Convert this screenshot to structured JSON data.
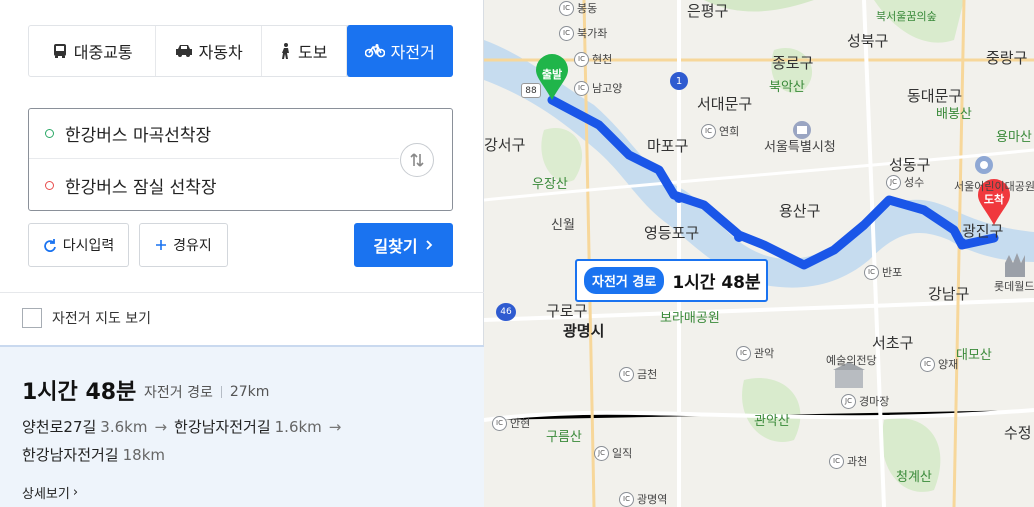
{
  "modes": [
    {
      "label": "대중교통",
      "icon": "bus-icon"
    },
    {
      "label": "자동차",
      "icon": "car-icon"
    },
    {
      "label": "도보",
      "icon": "walk-icon"
    },
    {
      "label": "자전거",
      "icon": "bicycle-icon"
    }
  ],
  "active_mode": "자전거",
  "route": {
    "origin": "한강버스 마곡선착장",
    "destination": "한강버스 잠실 선착장"
  },
  "buttons": {
    "reset": "다시입력",
    "via": "경유지",
    "search": "길찾기"
  },
  "bike_map_toggle": "자전거 지도 보기",
  "result": {
    "time": "1시간 48분",
    "type": "자전거 경로",
    "distance": "27km",
    "segments": [
      {
        "name": "양천로27길",
        "km": "3.6km"
      },
      {
        "name": "한강남자전거길",
        "km": "1.6km"
      },
      {
        "name": "한강남자전거길",
        "km": "18km"
      }
    ],
    "detail": "상세보기"
  },
  "map": {
    "badge_tag": "자전거 경로",
    "badge_time": "1시간 48분",
    "start_label": "출발",
    "end_label": "도착",
    "labels": [
      {
        "t": "은평구",
        "cls": "big"
      },
      {
        "t": "성북구",
        "cls": "big"
      },
      {
        "t": "북서울꿈의숲",
        "cls": "green small"
      },
      {
        "t": "중랑구",
        "cls": "big"
      },
      {
        "t": "종로구",
        "cls": "big"
      },
      {
        "t": "북악산",
        "cls": "green"
      },
      {
        "t": "동대문구",
        "cls": "big"
      },
      {
        "t": "배봉산",
        "cls": "green"
      },
      {
        "t": "서대문구",
        "cls": "big"
      },
      {
        "t": "서울특별시청",
        "cls": ""
      },
      {
        "t": "마포구",
        "cls": "big"
      },
      {
        "t": "용마산",
        "cls": "green"
      },
      {
        "t": "성동구",
        "cls": "big"
      },
      {
        "t": "서울어린이대공원",
        "cls": ""
      },
      {
        "t": "강서구",
        "cls": "big"
      },
      {
        "t": "우장산",
        "cls": "green"
      },
      {
        "t": "용산구",
        "cls": "big"
      },
      {
        "t": "광진구",
        "cls": "big"
      },
      {
        "t": "신월",
        "cls": ""
      },
      {
        "t": "영등포구",
        "cls": "big"
      },
      {
        "t": "구로구",
        "cls": "big"
      },
      {
        "t": "광명시",
        "cls": "bold"
      },
      {
        "t": "보라매공원",
        "cls": "green"
      },
      {
        "t": "강남구",
        "cls": "big"
      },
      {
        "t": "롯데월드",
        "cls": ""
      },
      {
        "t": "서초구",
        "cls": "big"
      },
      {
        "t": "예술의전당",
        "cls": ""
      },
      {
        "t": "대모산",
        "cls": "green"
      },
      {
        "t": "관악산",
        "cls": "green"
      },
      {
        "t": "구름산",
        "cls": "green"
      },
      {
        "t": "청계산",
        "cls": "green"
      },
      {
        "t": "수정",
        "cls": "big"
      }
    ],
    "ics": [
      "봉동",
      "북가좌",
      "현천",
      "남고양",
      "연희",
      "성수",
      "반포",
      "금천",
      "관악",
      "양재",
      "경마장",
      "안현",
      "일직",
      "과천",
      "광명역"
    ],
    "road_numbers": [
      "1",
      "88",
      "46"
    ]
  }
}
